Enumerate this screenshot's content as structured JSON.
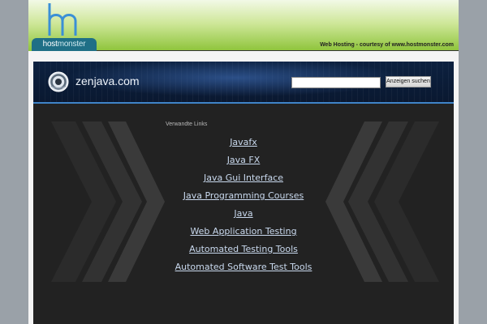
{
  "brand": {
    "logo_word_1": "host",
    "logo_word_2": "monster",
    "courtesy_text": "Web Hosting - courtesy of www.hostmonster.com",
    "colors": {
      "green": "#8ec43a",
      "teal": "#1f6f86",
      "blue_mark": "#3a8fd6"
    }
  },
  "site": {
    "name": "zenjava.com",
    "search": {
      "placeholder": "",
      "value": "",
      "button_label": "Anzeigen suchen"
    }
  },
  "related": {
    "heading": "Verwandte Links",
    "links": [
      "Javafx",
      "Java FX",
      "Java Gui Interface",
      "Java Programming Courses",
      "Java",
      "Web Application Testing",
      "Automated Testing Tools",
      "Automated Software Test Tools"
    ]
  }
}
